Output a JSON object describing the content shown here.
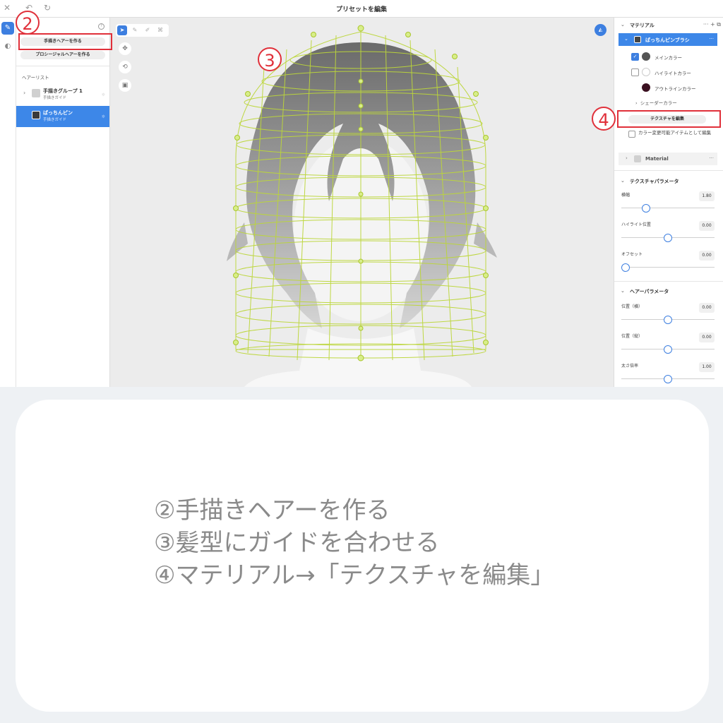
{
  "app": {
    "title": "プリセットを編集",
    "icons": {
      "close": "close-icon",
      "undo": "undo-icon",
      "redo": "redo-icon"
    }
  },
  "left_panel": {
    "make_hand_drawn_button": "手描きヘアーを作る",
    "make_procedural_button": "プロシージャルヘアーを作る",
    "hair_list_label": "ヘアーリスト",
    "items": [
      {
        "name": "手描きグループ 1",
        "sub": "手描きガイド",
        "selected": false,
        "swatch": "#d0d0d0"
      },
      {
        "name": "ぱっちんピン",
        "sub": "手描きガイド",
        "selected": true,
        "swatch": "#3a3a3a"
      }
    ]
  },
  "right_panel": {
    "material_header": "マテリアル",
    "material_name": "ぱっちんピンブラシ",
    "colors": [
      {
        "label": "メインカラー",
        "checked": true,
        "color": "#555555"
      },
      {
        "label": "ハイライトカラー",
        "checked": false,
        "color": "#ffffff"
      },
      {
        "label": "アウトラインカラー",
        "checked": null,
        "color": "#3a1020"
      }
    ],
    "shader_color": "シェーダーカラー",
    "edit_texture_button": "テクスチャを編集",
    "editable_item_label": "カラー変更可能アイテムとして編集",
    "material2_name": "Material",
    "texture_params_header": "テクスチャパラメータ",
    "texture_params": [
      {
        "label": "横幅",
        "value": "1.80",
        "level": 0.24
      },
      {
        "label": "ハイライト位置",
        "value": "0.00",
        "level": 0.5
      },
      {
        "label": "オフセット",
        "value": "0.00",
        "level": 0.0
      }
    ],
    "hair_params_header": "ヘアーパラメータ",
    "hair_params": [
      {
        "label": "位置（横）",
        "value": "0.00",
        "level": 0.5
      },
      {
        "label": "位置（縦）",
        "value": "0.00",
        "level": 0.5
      },
      {
        "label": "太さ倍率",
        "value": "1.00",
        "level": 0.5
      }
    ]
  },
  "annotations": {
    "a2": "2",
    "a3": "3",
    "a4": "4"
  },
  "steps": [
    "②手描きヘアーを作る",
    "③髪型にガイドを合わせる",
    "④マテリアル→「テクスチャを編集」"
  ],
  "colors": {
    "accent": "#3d7fe0",
    "annotation": "#e0303a",
    "guide_mesh": "#bcd63a"
  }
}
